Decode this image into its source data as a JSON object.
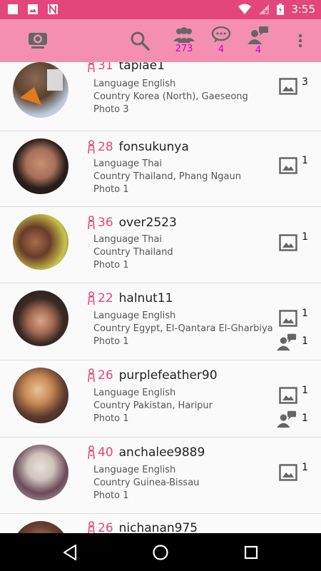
{
  "status_bar": {
    "time": "3:55"
  },
  "app_bar": {
    "users_count": "273",
    "messages_count": "4",
    "requests_count": "4"
  },
  "users": [
    {
      "age": "31",
      "username": "tapiae1",
      "language": "Language English",
      "country": "Country Korea (North), Gaeseong",
      "photos": "Photo 3",
      "photo_count": "3",
      "msg_count": ""
    },
    {
      "age": "28",
      "username": "fonsukunya",
      "language": "Language Thai",
      "country": "Country Thailand, Phang Ngaun",
      "photos": "Photo 1",
      "photo_count": "1",
      "msg_count": ""
    },
    {
      "age": "36",
      "username": "over2523",
      "language": "Language Thai",
      "country": "Country Thailand",
      "photos": "Photo 1",
      "photo_count": "1",
      "msg_count": ""
    },
    {
      "age": "22",
      "username": "halnut11",
      "language": "Language English",
      "country": "Country Egypt, El-Qantara El-Gharbiya",
      "photos": "Photo 1",
      "photo_count": "1",
      "msg_count": "1"
    },
    {
      "age": "26",
      "username": "purplefeather90",
      "language": "Language English",
      "country": "Country Pakistan, Haripur",
      "photos": "Photo 1",
      "photo_count": "1",
      "msg_count": "1"
    },
    {
      "age": "40",
      "username": "anchalee9889",
      "language": "Language English",
      "country": "Country Guinea-Bissau",
      "photos": "Photo 1",
      "photo_count": "1",
      "msg_count": ""
    },
    {
      "age": "26",
      "username": "nichanan975",
      "language": "",
      "country": "",
      "photos": "",
      "photo_count": "",
      "msg_count": ""
    }
  ],
  "colors": {
    "status_bar": "#e3467a",
    "app_bar": "#f48fb1",
    "accent": "#e3467a",
    "count": "#d100d1"
  },
  "icons": [
    "camera-icon",
    "search-icon",
    "users-icon",
    "chat-icon",
    "contact-request-icon",
    "more-vert-icon",
    "female-icon",
    "photo-icon",
    "back-icon",
    "home-icon",
    "recents-icon"
  ]
}
